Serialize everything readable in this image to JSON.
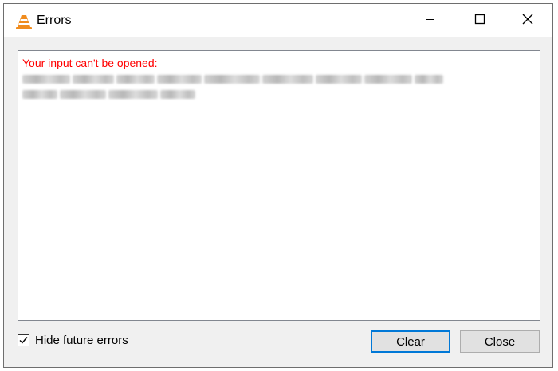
{
  "window": {
    "title": "Errors",
    "app_icon": "vlc-cone-icon",
    "controls": {
      "minimize": "minimize-icon",
      "maximize": "maximize-icon",
      "close": "close-icon"
    }
  },
  "errors": {
    "heading": "Your input can't be opened:",
    "heading_color": "#ff0000",
    "detail_redacted": true
  },
  "footer": {
    "hide_future_errors": {
      "label": "Hide future errors",
      "checked": true
    },
    "clear_label": "Clear",
    "close_label": "Close"
  },
  "colors": {
    "accent_border": "#0078d7",
    "vlc_orange": "#f08c1e"
  }
}
